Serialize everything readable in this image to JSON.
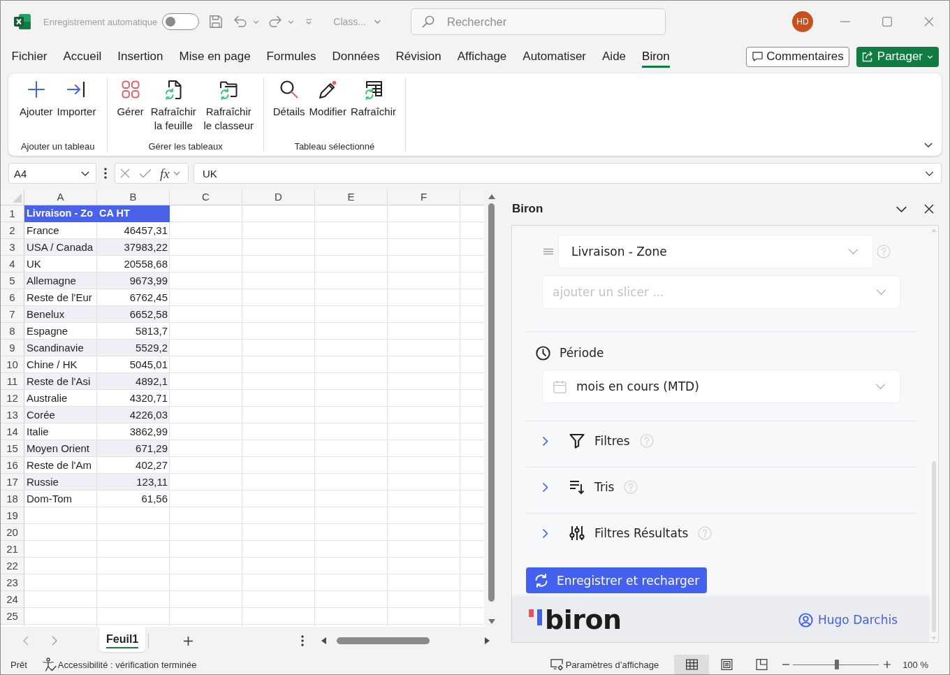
{
  "title_bar": {
    "autosave": {
      "label": "Enregistrement automatique",
      "on": false
    },
    "file_name": "Class...",
    "search": {
      "placeholder": "Rechercher"
    },
    "avatar": "HD"
  },
  "ribbon_tabs": [
    {
      "label": "Fichier",
      "selected": false
    },
    {
      "label": "Accueil",
      "selected": false
    },
    {
      "label": "Insertion",
      "selected": false
    },
    {
      "label": "Mise en page",
      "selected": false
    },
    {
      "label": "Formules",
      "selected": false
    },
    {
      "label": "Données",
      "selected": false
    },
    {
      "label": "Révision",
      "selected": false
    },
    {
      "label": "Affichage",
      "selected": false
    },
    {
      "label": "Automatiser",
      "selected": false
    },
    {
      "label": "Aide",
      "selected": false
    },
    {
      "label": "Biron",
      "selected": true
    }
  ],
  "comments_button": "Commentaires",
  "share_button": "Partager",
  "ribbon_groups": [
    {
      "label": "Ajouter un tableau",
      "buttons": [
        {
          "kind": "plus",
          "label": "Ajouter"
        },
        {
          "kind": "import",
          "label": "Importer"
        }
      ]
    },
    {
      "label": "Gérer les tableaux",
      "buttons": [
        {
          "kind": "grid",
          "label": "Gérer"
        },
        {
          "kind": "refresh_sheet",
          "label": "Rafraîchir la feuille"
        },
        {
          "kind": "refresh_workbook",
          "label": "Rafraîchir le classeur"
        }
      ]
    },
    {
      "label": "Tableau sélectionné",
      "buttons": [
        {
          "kind": "details",
          "label": "Détails"
        },
        {
          "kind": "edit",
          "label": "Modifier"
        },
        {
          "kind": "refresh_table",
          "label": "Rafraîchir"
        }
      ]
    }
  ],
  "formula_bar": {
    "name_box": "A4",
    "function_button": "fx",
    "formula": "UK"
  },
  "sheet": {
    "columns": [
      "A",
      "B",
      "C",
      "D",
      "E",
      "F"
    ],
    "rows": [
      {
        "number": "1",
        "kind": "header",
        "cells": [
          "Livraison - Zo",
          "CA HT"
        ]
      },
      {
        "number": "2",
        "kind": "data",
        "cells": [
          "France",
          "46457,31"
        ]
      },
      {
        "number": "3",
        "kind": "data",
        "cells": [
          "USA / Canada",
          "37983,22"
        ]
      },
      {
        "number": "4",
        "kind": "data",
        "cells": [
          "UK",
          "20558,68"
        ]
      },
      {
        "number": "5",
        "kind": "data",
        "cells": [
          "Allemagne",
          "9673,99"
        ]
      },
      {
        "number": "6",
        "kind": "data",
        "cells": [
          "Reste de l'Eur",
          "6762,45"
        ]
      },
      {
        "number": "7",
        "kind": "data",
        "cells": [
          "Benelux",
          "6652,58"
        ]
      },
      {
        "number": "8",
        "kind": "data",
        "cells": [
          "Espagne",
          "5813,7"
        ]
      },
      {
        "number": "9",
        "kind": "data",
        "cells": [
          "Scandinavie",
          "5529,2"
        ]
      },
      {
        "number": "10",
        "kind": "data",
        "cells": [
          "Chine / HK",
          "5045,01"
        ]
      },
      {
        "number": "11",
        "kind": "data",
        "cells": [
          "Reste de l'Asi",
          "4892,1"
        ]
      },
      {
        "number": "12",
        "kind": "data",
        "cells": [
          "Australie",
          "4320,71"
        ]
      },
      {
        "number": "13",
        "kind": "data",
        "cells": [
          "Corée",
          "4226,03"
        ]
      },
      {
        "number": "14",
        "kind": "data",
        "cells": [
          "Italie",
          "3862,99"
        ]
      },
      {
        "number": "15",
        "kind": "data",
        "cells": [
          "Moyen Orient",
          "671,29"
        ]
      },
      {
        "number": "16",
        "kind": "data",
        "cells": [
          "Reste de l'Am",
          "402,27"
        ]
      },
      {
        "number": "17",
        "kind": "data",
        "cells": [
          "Russie",
          "123,11"
        ]
      },
      {
        "number": "18",
        "kind": "data",
        "cells": [
          "Dom-Tom",
          "61,56"
        ]
      },
      {
        "number": "19",
        "kind": "empty"
      },
      {
        "number": "20",
        "kind": "empty"
      },
      {
        "number": "21",
        "kind": "empty"
      },
      {
        "number": "22",
        "kind": "empty"
      },
      {
        "number": "23",
        "kind": "empty"
      },
      {
        "number": "24",
        "kind": "empty"
      },
      {
        "number": "25",
        "kind": "empty"
      }
    ]
  },
  "sheet_tabs": [
    {
      "label": "Feuil1",
      "selected": true
    }
  ],
  "task_pane": {
    "title": "Biron",
    "slicers": [
      {
        "value": "Livraison - Zone"
      }
    ],
    "add_slicer": {
      "placeholder": "ajouter un slicer ..."
    },
    "period": {
      "label": "Période",
      "value": "mois en cours (MTD)"
    },
    "sections": [
      {
        "kind": "filter",
        "label": "Filtres",
        "expanded": false
      },
      {
        "kind": "sort",
        "label": "Tris",
        "expanded": false
      },
      {
        "kind": "result_filter",
        "label": "Filtres Résultats",
        "expanded": false
      }
    ],
    "save_button": "Enregistrer et recharger",
    "logo": "biron",
    "user": "Hugo Darchis"
  },
  "status_bar": {
    "mode": "Prêt",
    "accessibility": "Accessibilité : vérification terminée",
    "display_settings": "Paramètres d’affichage",
    "views": [
      {
        "kind": "normal",
        "selected": true
      },
      {
        "kind": "page_layout",
        "selected": false
      },
      {
        "kind": "page_break",
        "selected": false
      }
    ],
    "zoom": {
      "level": 0.51,
      "reading": "100 %"
    }
  }
}
